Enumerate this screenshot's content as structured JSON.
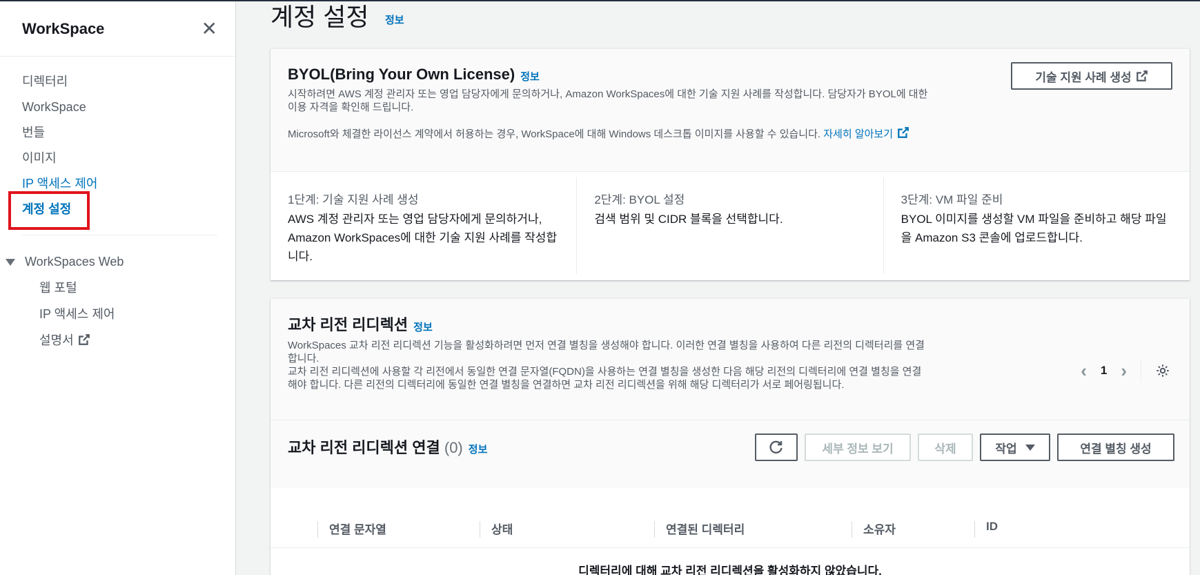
{
  "sidebar": {
    "title": "WorkSpace",
    "items": [
      {
        "label": "디렉터리"
      },
      {
        "label": "WorkSpace"
      },
      {
        "label": "번들"
      },
      {
        "label": "이미지"
      },
      {
        "label": "IP 액세스 제어"
      },
      {
        "label": "계정 설정"
      }
    ],
    "section": {
      "label": "WorkSpaces Web",
      "items": [
        {
          "label": "웹 포털"
        },
        {
          "label": "IP 액세스 제어"
        },
        {
          "label": "설명서"
        }
      ]
    }
  },
  "page": {
    "title": "계정 설정",
    "info": "정보"
  },
  "byol": {
    "title": "BYOL(Bring Your Own License)",
    "info": "정보",
    "desc1": "시작하려면 AWS 계정 관리자 또는 영업 담당자에게 문의하거나, Amazon WorkSpaces에 대한 기술 지원 사례를 작성합니다. 담당자가 BYOL에 대한 이용 자격을 확인해 드립니다.",
    "desc2": "Microsoft와 체결한 라이선스 계약에서 허용하는 경우, WorkSpace에 대해 Windows 데스크톱 이미지를 사용할 수 있습니다.",
    "learn_more": "자세히 알아보기",
    "support_button": "기술 지원 사례 생성",
    "steps": [
      {
        "label": "1단계: 기술 지원 사례 생성",
        "text": "AWS 계정 관리자 또는 영업 담당자에게 문의하거나, Amazon WorkSpaces에 대한 기술 지원 사례를 작성합니다."
      },
      {
        "label": "2단계: BYOL 설정",
        "text": "검색 범위 및 CIDR 블록을 선택합니다."
      },
      {
        "label": "3단계: VM 파일 준비",
        "text": "BYOL 이미지를 생성할 VM 파일을 준비하고 해당 파일을 Amazon S3 콘솔에 업로드합니다."
      }
    ]
  },
  "redirect": {
    "title": "교차 리전 리디렉션",
    "info": "정보",
    "desc1": "WorkSpaces 교차 리전 리디렉션 기능을 활성화하려면 먼저 연결 별칭을 생성해야 합니다. 이러한 연결 별칭을 사용하여 다른 리전의 디렉터리를 연결합니다.",
    "desc2": "교차 리전 리디렉션에 사용할 각 리전에서 동일한 연결 문자열(FQDN)을 사용하는 연결 별칭을 생성한 다음 해당 리전의 디렉터리에 연결 별칭을 연결해야 합니다. 다른 리전의 디렉터리에 동일한 연결 별칭을 연결하면 교차 리전 리디렉션을 위해 해당 디렉터리가 서로 페어링됩니다.",
    "connections": {
      "title": "교차 리전 리디렉션 연결",
      "count": "(0)",
      "info": "정보",
      "buttons": {
        "details": "세부 정보 보기",
        "delete": "삭제",
        "actions": "작업",
        "create": "연결 별칭 생성"
      },
      "page": "1",
      "columns": [
        "연결 문자열",
        "상태",
        "연결된 디렉터리",
        "소유자",
        "ID"
      ],
      "empty": "디렉터리에 대해 교차 리전 리디렉션을 활성화하지 않았습니다."
    }
  }
}
